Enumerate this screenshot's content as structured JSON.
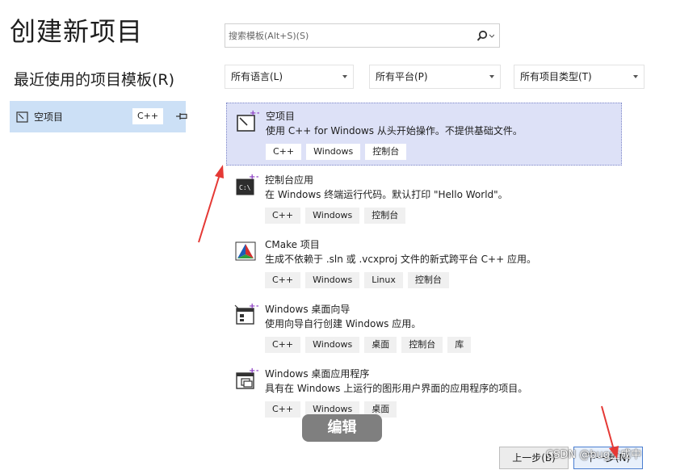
{
  "page_title": "创建新项目",
  "recent": {
    "title": "最近使用的项目模板(R)",
    "items": [
      {
        "label": "空项目",
        "tag": "C++"
      }
    ]
  },
  "search": {
    "placeholder": "搜索模板(Alt+S)(S)"
  },
  "filters": {
    "language": "所有语言(L)",
    "platform": "所有平台(P)",
    "project_type": "所有项目类型(T)"
  },
  "templates": [
    {
      "name": "空项目",
      "description": "使用 C++ for Windows 从头开始操作。不提供基础文件。",
      "tags": [
        "C++",
        "Windows",
        "控制台"
      ]
    },
    {
      "name": "控制台应用",
      "description": "在 Windows 终端运行代码。默认打印 \"Hello World\"。",
      "tags": [
        "C++",
        "Windows",
        "控制台"
      ]
    },
    {
      "name": "CMake 项目",
      "description": "生成不依赖于 .sln 或 .vcxproj 文件的新式跨平台 C++ 应用。",
      "tags": [
        "C++",
        "Windows",
        "Linux",
        "控制台"
      ]
    },
    {
      "name": "Windows 桌面向导",
      "description": "使用向导自行创建 Windows 应用。",
      "tags": [
        "C++",
        "Windows",
        "桌面",
        "控制台",
        "库"
      ]
    },
    {
      "name": "Windows 桌面应用程序",
      "description": "具有在 Windows 上运行的图形用户界面的应用程序的项目。",
      "tags": [
        "C++",
        "Windows",
        "桌面"
      ]
    }
  ],
  "overlay_label": "编辑",
  "buttons": {
    "back": "上一步(B)",
    "next": "下一步(N)"
  },
  "watermark": "CSDN @bug生成中",
  "colors": {
    "selected_bg": "#dde1f7",
    "recent_bg": "#cce0f6",
    "annotation_arrow": "#e53935"
  }
}
